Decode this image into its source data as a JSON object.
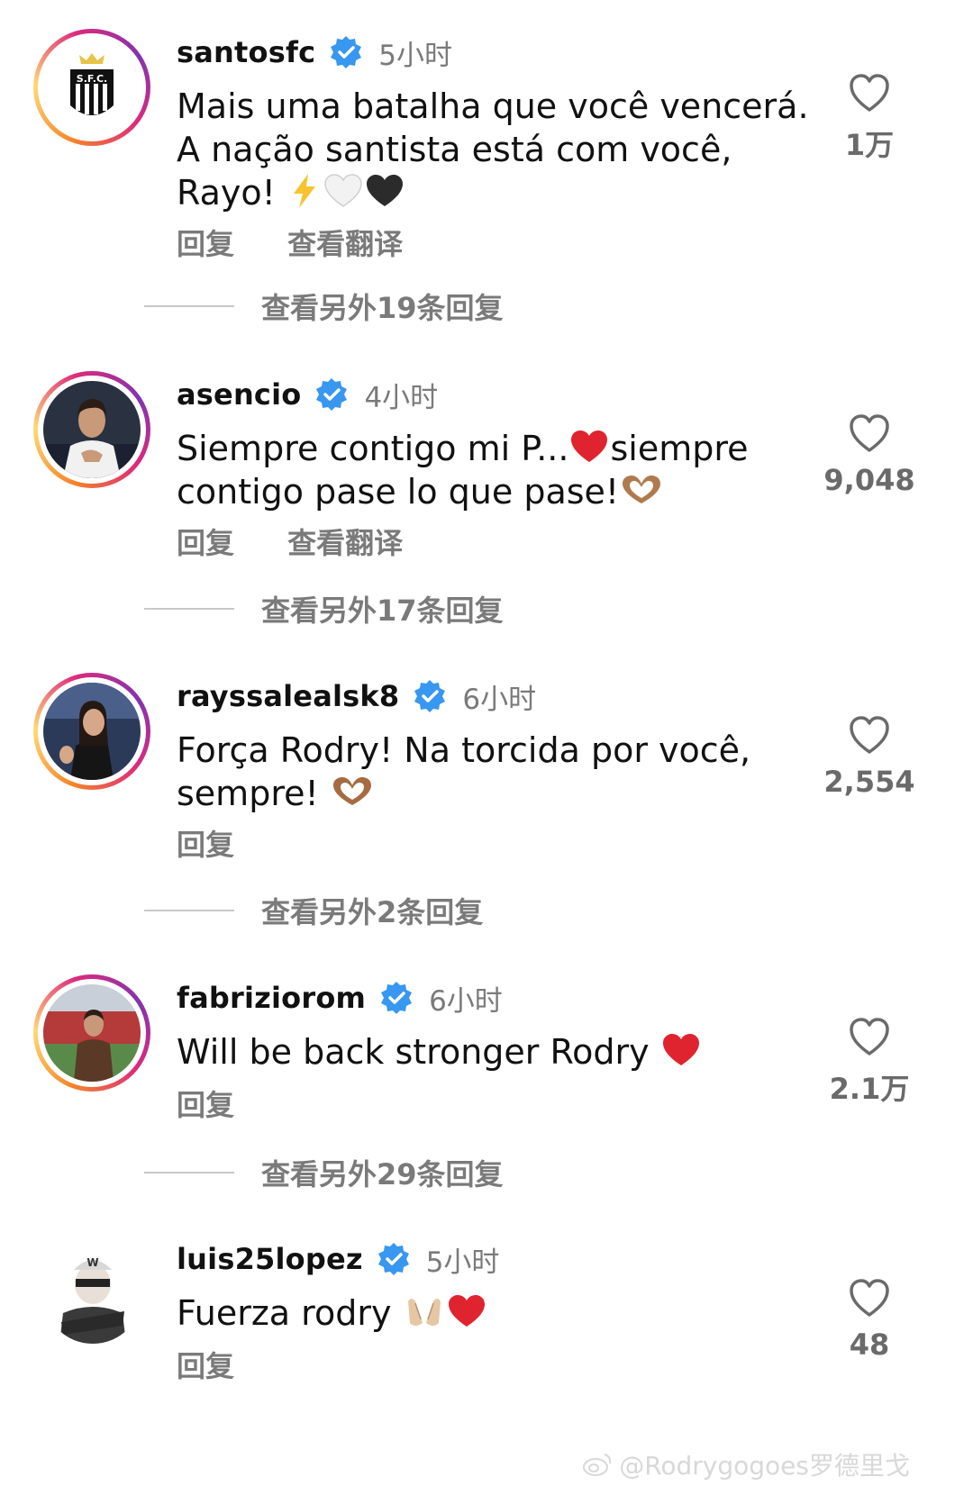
{
  "comments": [
    {
      "username": "santosfc",
      "time": "5小时",
      "text_lines": [
        "Mais uma batalha que você vencerá.",
        "A nação santista está com você,",
        "Rayo! "
      ],
      "actions": [
        "回复",
        "查看翻译"
      ],
      "likes": "1万",
      "more_replies": "查看另外19条回复",
      "avatar": "santos-crest",
      "story_ring": true
    },
    {
      "username": "asencio",
      "time": "4小时",
      "text_lines": [
        "Siempre contigo mi P...",
        "siempre",
        "contigo pase lo que pase!"
      ],
      "actions": [
        "回复",
        "查看翻译"
      ],
      "likes": "9,048",
      "more_replies": "查看另外17条回复",
      "avatar": "player-photo",
      "story_ring": true
    },
    {
      "username": "rayssalealsk8",
      "time": "6小时",
      "text_lines": [
        "Força Rodry! Na torcida por você,",
        "sempre! "
      ],
      "actions": [
        "回复"
      ],
      "likes": "2,554",
      "more_replies": "查看另外2条回复",
      "avatar": "woman-photo",
      "story_ring": true
    },
    {
      "username": "fabriziorom",
      "time": "6小时",
      "text_lines": [
        "Will be back stronger Rodry "
      ],
      "actions": [
        "回复"
      ],
      "likes": "2.1万",
      "more_replies": "查看另外29条回复",
      "avatar": "man-stadium-photo",
      "story_ring": true
    },
    {
      "username": "luis25lopez",
      "time": "5小时",
      "text_lines": [
        "Fuerza rodry "
      ],
      "actions": [
        "回复"
      ],
      "likes": "48",
      "avatar": "cartoon-character",
      "story_ring": false
    }
  ],
  "watermark": "@Rodrygogoes罗德里戈",
  "colors": {
    "verified_blue": "#3897f0",
    "heart_red": "#e0242f",
    "muted_text": "#7a7a7a"
  }
}
